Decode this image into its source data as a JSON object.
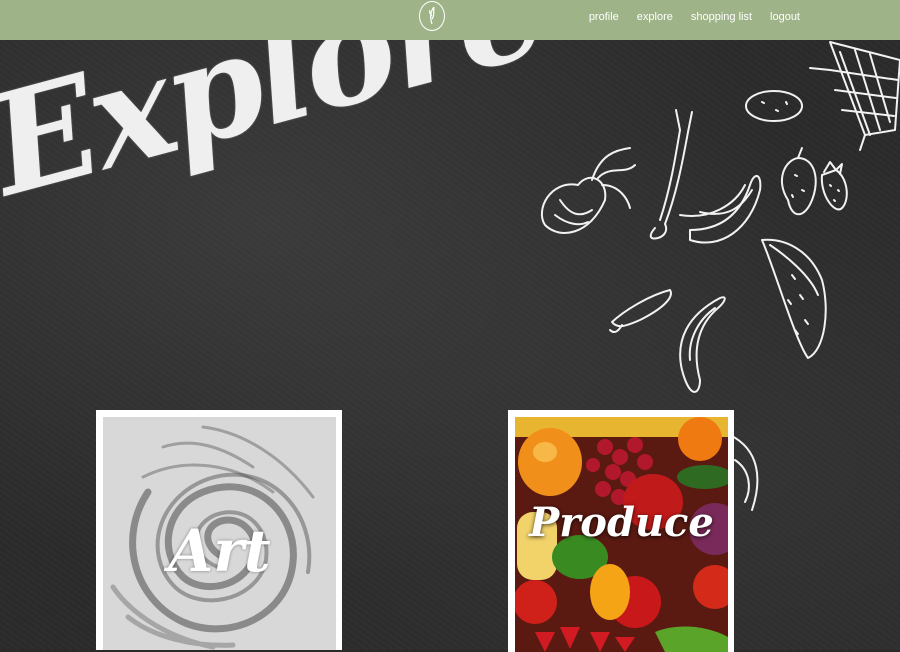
{
  "nav": {
    "logo_icon": "leaf-logo-icon",
    "links": [
      {
        "label": "profile"
      },
      {
        "label": "explore"
      },
      {
        "label": "shopping list"
      },
      {
        "label": "logout"
      }
    ]
  },
  "page": {
    "title": "Explore"
  },
  "cards": [
    {
      "label": "Art"
    },
    {
      "label": "Produce"
    }
  ],
  "colors": {
    "navbar": "#9fb388",
    "chalkboard": "#2b2b2b",
    "chalk": "#efefef"
  }
}
